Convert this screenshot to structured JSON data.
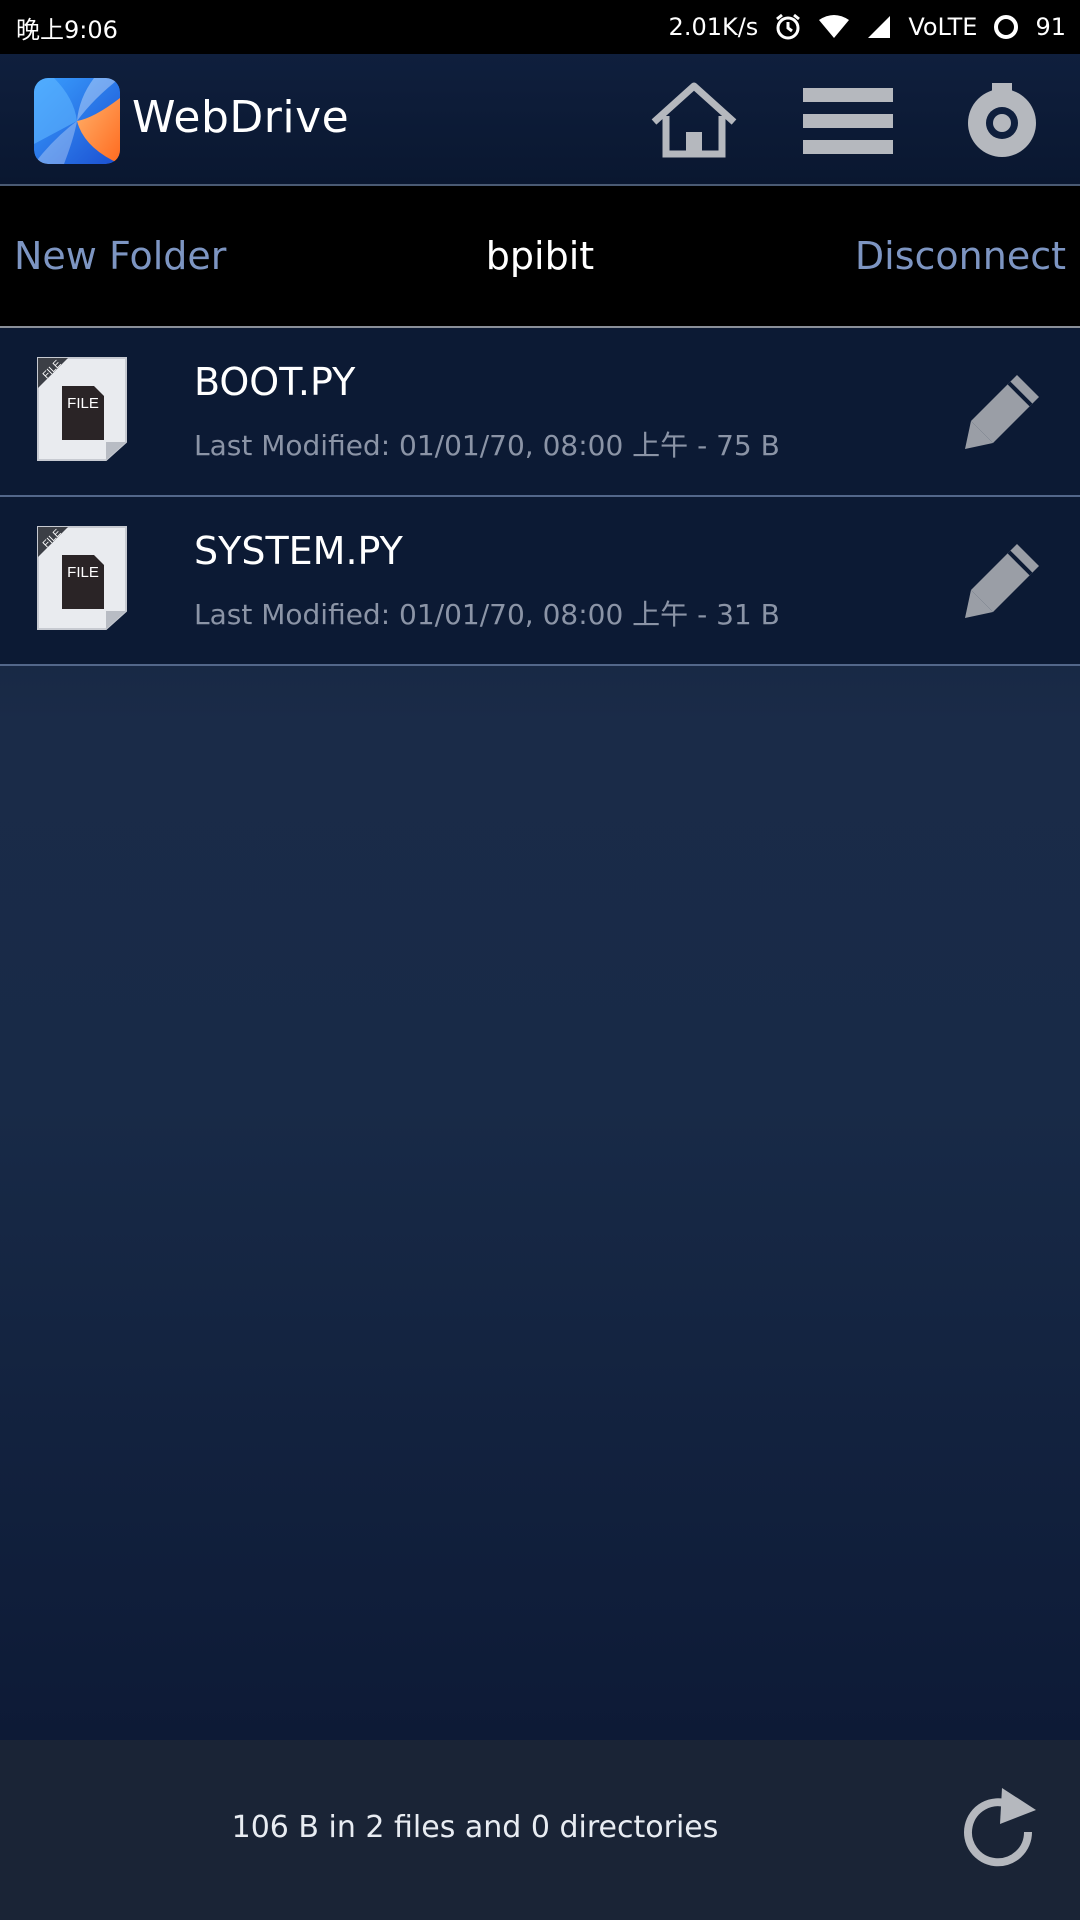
{
  "status_bar": {
    "time": "晚上9:06",
    "net_speed": "2.01K/s",
    "network": "VoLTE",
    "battery": "91"
  },
  "app": {
    "title": "WebDrive",
    "icons": [
      "home-icon",
      "menu-icon",
      "settings-icon"
    ]
  },
  "path_bar": {
    "new_folder": "New Folder",
    "current": "bpibit",
    "disconnect": "Disconnect"
  },
  "files": [
    {
      "name": "BOOT.PY",
      "meta": "Last Modified: 01/01/70, 08:00 上午 - 75 B",
      "icon_label": "FILE"
    },
    {
      "name": "SYSTEM.PY",
      "meta": "Last Modified: 01/01/70, 08:00 上午 - 31 B",
      "icon_label": "FILE"
    }
  ],
  "footer": {
    "summary": "106 B in 2 files and 0 directories"
  },
  "colors": {
    "accent_link": "#7d95c2",
    "header_bg": "#0f1f3d",
    "list_bg": "#0c1a34"
  }
}
